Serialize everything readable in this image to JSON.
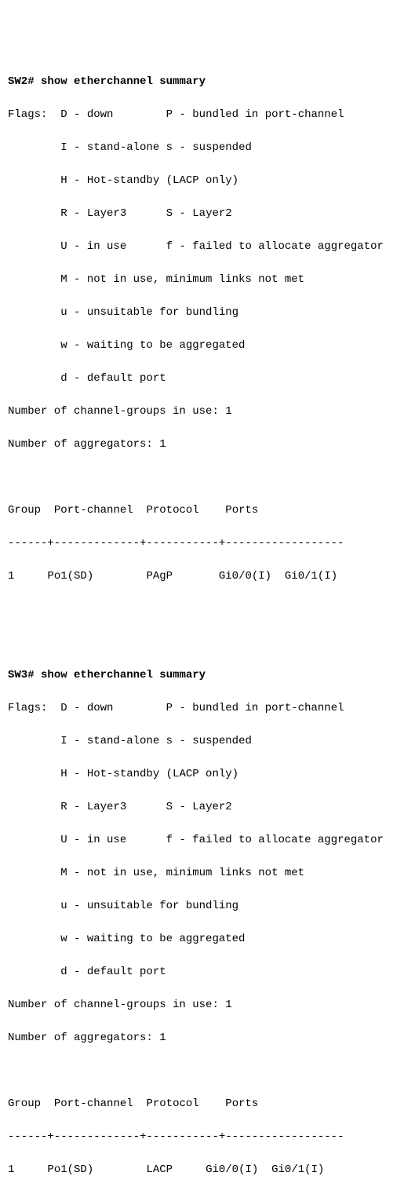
{
  "sw2": {
    "prompt": "SW2#",
    "command": "show etherchannel summary",
    "flags_label": "Flags:",
    "flags": {
      "l1a": "D - down",
      "l1b": "P - bundled in port-channel",
      "l2a": "I - stand-alone",
      "l2b": "s - suspended",
      "l3": "H - Hot-standby (LACP only)",
      "l4a": "R - Layer3",
      "l4b": "S - Layer2",
      "l5a": "U - in use",
      "l5b": "f - failed to allocate aggregator",
      "l6": "M - not in use, minimum links not met",
      "l7": "u - unsuitable for bundling",
      "l8": "w - waiting to be aggregated",
      "l9": "d - default port"
    },
    "groups_label": "Number of channel-groups in use:",
    "groups_value": "1",
    "agg_label": "Number of aggregators:",
    "agg_value": "1",
    "header": {
      "c1": "Group",
      "c2": "Port-channel",
      "c3": "Protocol",
      "c4": "Ports"
    },
    "divider": "------+-------------+-----------+------------------",
    "row": {
      "group": "1",
      "port_channel": "Po1(SD)",
      "protocol": "PAgP",
      "port1": "Gi0/0(I)",
      "port2": "Gi0/1(I)"
    }
  },
  "sw3": {
    "prompt": "SW3#",
    "command": "show etherchannel summary",
    "flags_label": "Flags:",
    "flags": {
      "l1a": "D - down",
      "l1b": "P - bundled in port-channel",
      "l2a": "I - stand-alone",
      "l2b": "s - suspended",
      "l3": "H - Hot-standby (LACP only)",
      "l4a": "R - Layer3",
      "l4b": "S - Layer2",
      "l5a": "U - in use",
      "l5b": "f - failed to allocate aggregator",
      "l6": "M - not in use, minimum links not met",
      "l7": "u - unsuitable for bundling",
      "l8": "w - waiting to be aggregated",
      "l9": "d - default port"
    },
    "groups_label": "Number of channel-groups in use:",
    "groups_value": "1",
    "agg_label": "Number of aggregators:",
    "agg_value": "1",
    "header": {
      "c1": "Group",
      "c2": "Port-channel",
      "c3": "Protocol",
      "c4": "Ports"
    },
    "divider": "------+-------------+-----------+------------------",
    "row": {
      "group": "1",
      "port_channel": "Po1(SD)",
      "protocol": "LACP",
      "port1": "Gi0/0(I)",
      "port2": "Gi0/1(I)"
    }
  }
}
